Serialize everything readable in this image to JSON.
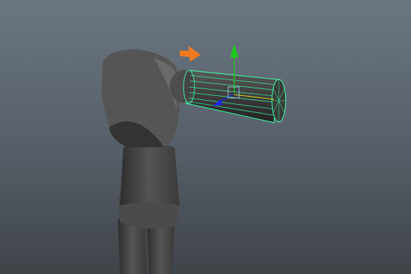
{
  "viewport": {
    "background_top": "#6b7682",
    "background_bottom": "#3f4449",
    "selection_color": "#3cf0a0",
    "annotation_arrow_color": "#f07a1e",
    "manipulator": {
      "y_axis_color": "#1ec81e",
      "z_axis_color": "#1e28e6",
      "x_axis_color": "#e6e61e"
    },
    "model_color": "#4a4a4a",
    "icons": [
      "orange-annotation-arrow",
      "move-manipulator",
      "selected-cylinder",
      "mannequin-model"
    ]
  }
}
